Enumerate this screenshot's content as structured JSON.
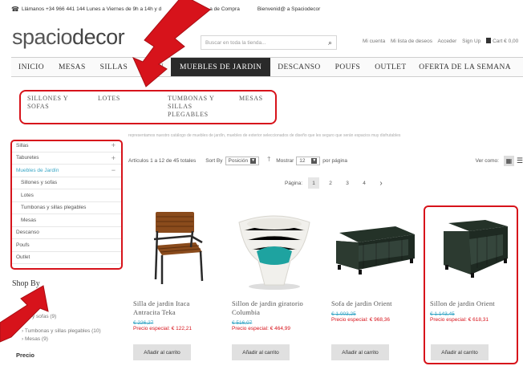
{
  "topbar": {
    "phone_text": "Llámanos +34 966 441 144 Lunes a Viernes de 9h a 14h y d",
    "condiciones": "a de Compra",
    "welcome": "Bienvenid@ a Spaciodecor"
  },
  "logo": {
    "part1": "spacio",
    "part2": "decor"
  },
  "search": {
    "placeholder": "Buscar en toda la tienda..."
  },
  "account": {
    "links": [
      "Mi cuenta",
      "Mi lista de deseos",
      "Acceder",
      "Sign Up"
    ],
    "cart": "Cart € 0,00"
  },
  "nav": {
    "items": [
      "INICIO",
      "MESAS",
      "SILLAS",
      "TABU",
      "MUEBLES DE JARDIN",
      "DESCANSO",
      "POUFS",
      "OUTLET"
    ],
    "right": "OFERTA DE LA SEMANA"
  },
  "mega": {
    "col1": "SILLONES Y SOFAS",
    "col2": "LOTES",
    "col3": "TUMBONAS Y SILLAS PLEGABLES",
    "col4": "MESAS"
  },
  "strip_text": "representamos nuestro catálogo de muebles de jardín, muebles de exterior seleccionados de diseño que les seguro que serán espacios muy disfrutables",
  "sidebar": {
    "items": [
      "Sillas",
      "Taburetes",
      "Muebles de Jardín",
      "Sillones y sofas",
      "Lotes",
      "Tumbonas y sillas plegables",
      "Mesas",
      "Descanso",
      "Poufs",
      "Outlet"
    ],
    "shop_by": "Shop By",
    "filter1": "y sofas (9)",
    "filter2": "Tumbonas y sillas plegables (10)",
    "filter3": "Mesas (9)",
    "price_label": "Precio"
  },
  "toolbar": {
    "count": "Artículos 1 a 12 de 45 totales",
    "sort_by": "Sort By",
    "sort_value": "Posición",
    "show": "Mostrar",
    "show_value": "12",
    "per_page": "por página",
    "view_as": "Ver como:"
  },
  "pager": {
    "label": "Página:",
    "pages": [
      "1",
      "2",
      "3",
      "4"
    ],
    "next": "›"
  },
  "products": [
    {
      "name": "Silla de jardin Itaca Antracita Teka",
      "old": "€ 226,27",
      "special": "Precio especial: € 122,21",
      "button": "Añadir al carrito"
    },
    {
      "name": "Sillon de jardin giratorio Columbia",
      "old": "€ 516,07",
      "special": "Precio especial: € 464,99",
      "button": "Añadir al carrito"
    },
    {
      "name": "Sofa de jardin Orient",
      "old": "€ 1.003,25",
      "special": "Precio especial: € 968,36",
      "button": "Añadir al carrito"
    },
    {
      "name": "Sillon de jardin Orient",
      "old": "€ 1.143,45",
      "special": "Precio especial: € 618,31",
      "button": "Añadir al carrito"
    }
  ],
  "colors": {
    "highlight": "#d7131b",
    "accent": "#3aa7c6",
    "nav_active": "#2a2a2a"
  }
}
